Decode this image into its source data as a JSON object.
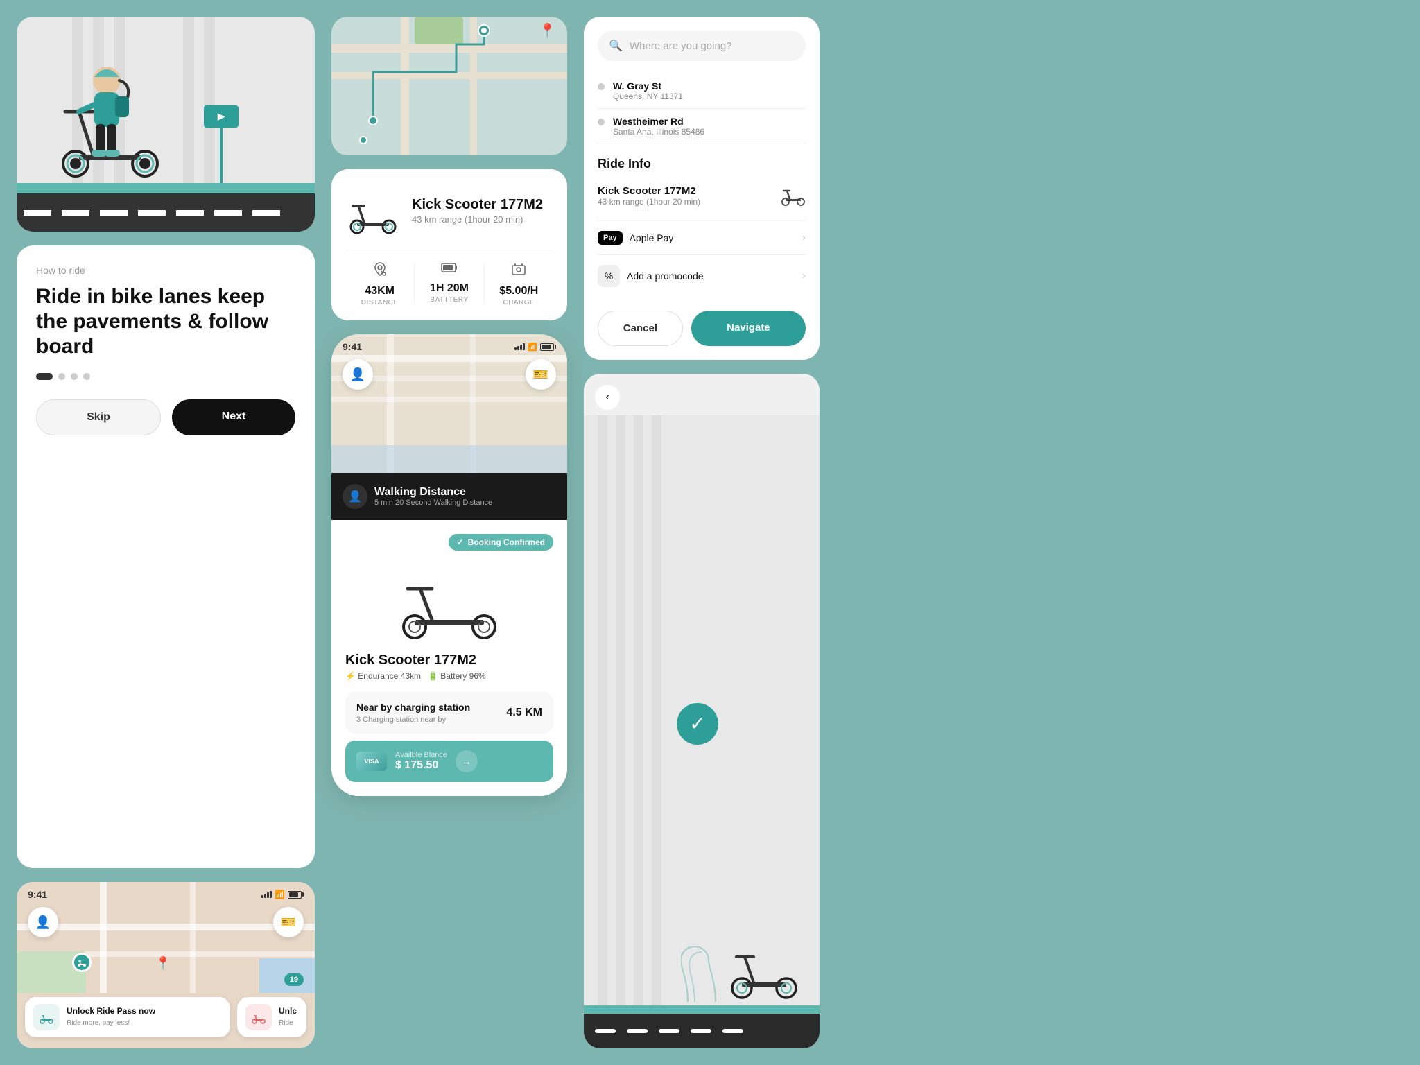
{
  "app": {
    "bg_color": "#7fb5b0",
    "teal_accent": "#2d9e98",
    "teal_light": "#5db8b0"
  },
  "col1": {
    "hero": {
      "back_label": "‹"
    },
    "how_to_ride": {
      "label": "How to ride",
      "title": "Ride in bike lanes keep the pavements & follow board",
      "dot_count": 4,
      "active_dot": 0,
      "skip_label": "Skip",
      "next_label": "Next"
    },
    "map_small": {
      "time": "9:41",
      "ride_pass_1_title": "Unlock Ride Pass now",
      "ride_pass_1_sub": "Ride more, pay less!",
      "ride_pass_2_title": "Unlc",
      "ride_pass_2_sub": "Ride"
    }
  },
  "col2": {
    "scooter_card": {
      "name": "Kick Scooter 177M2",
      "range": "43 km range (1hour 20 min)",
      "stats": [
        {
          "icon": "📍",
          "value": "43KM",
          "label": "DISTANCE"
        },
        {
          "icon": "🔋",
          "value": "1H 20M",
          "label": "BATTTERY"
        },
        {
          "icon": "💰",
          "value": "$5.00/H",
          "label": "CHARGE"
        }
      ]
    },
    "phone": {
      "time": "9:41",
      "walking": {
        "title": "Walking Distance",
        "sub": "5 min 20 Second Walking Distance"
      },
      "booking": {
        "confirmed_label": "Booking Confirmed",
        "scooter_name": "Kick Scooter 177M2",
        "endurance": "Endurance 43km",
        "battery": "Battery 96%",
        "nearby_title": "Near by charging station",
        "nearby_sub": "3 Charging station near by",
        "nearby_km": "4.5 KM",
        "balance_title": "Availble Blance",
        "balance_amount": "$ 175.50"
      }
    }
  },
  "col3": {
    "map_top": {
      "scooter_name": "Kick Scooter 177M2",
      "range": "43 km range (1hour 20 min)",
      "stats": [
        {
          "value": "43KM",
          "label": "DISTANCE"
        },
        {
          "value": "1H 20M",
          "label": "BATTTERY"
        },
        {
          "value": "$5.00/H",
          "label": "CHARGE"
        }
      ]
    }
  },
  "col4": {
    "search_panel": {
      "search_placeholder": "Where are you going?",
      "location1": {
        "name": "W. Gray St",
        "address": "Queens, NY 11371"
      },
      "location2": {
        "name": "Westheimer Rd",
        "address": "Santa Ana, Illinois 85486"
      },
      "ride_info": {
        "title": "Ride Info",
        "scooter_name": "Kick Scooter 177M2",
        "range": "43 km range (1hour 20 min)",
        "payment1_label": "Apple Pay",
        "payment2_label": "Add a promocode",
        "cancel_label": "Cancel",
        "navigate_label": "Navigate"
      }
    },
    "booking_confirmed": {
      "back_label": "‹"
    }
  }
}
